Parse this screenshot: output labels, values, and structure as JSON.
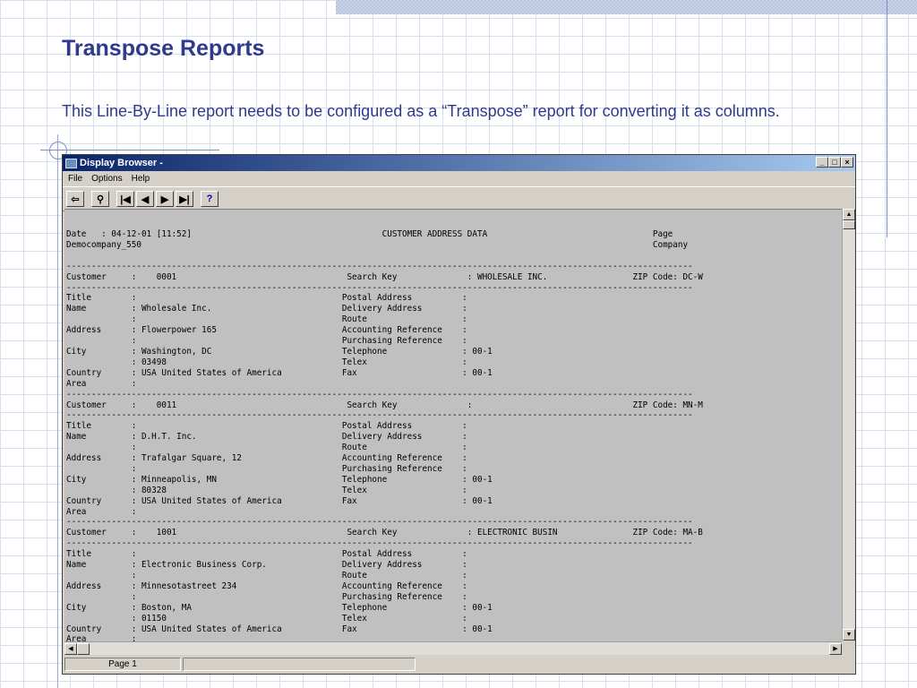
{
  "slide": {
    "title": "Transpose Reports",
    "subtitle": "This Line-By-Line report needs to be configured as a “Transpose” report for converting it as columns."
  },
  "window": {
    "title": "Display Browser -",
    "controls": {
      "minimize": "_",
      "maximize": "□",
      "close": "×"
    },
    "menu": [
      "File",
      "Options",
      "Help"
    ],
    "toolbar": [
      {
        "name": "exit-icon",
        "glyph": "⇦"
      },
      {
        "name": "binoculars-icon",
        "glyph": "⚲"
      },
      {
        "name": "first-page-icon",
        "glyph": "|◀"
      },
      {
        "name": "prev-page-icon",
        "glyph": "◀"
      },
      {
        "name": "next-page-icon",
        "glyph": "▶"
      },
      {
        "name": "last-page-icon",
        "glyph": "▶|"
      },
      {
        "name": "help-icon",
        "glyph": "?"
      }
    ],
    "status": {
      "page": "Page 1",
      "message": ""
    }
  },
  "report": {
    "lines": [
      "Date   : 04-12-01 [11:52]                                      CUSTOMER ADDRESS DATA                                 Page",
      "Democompany_550                                                                                                      Company",
      "",
      "-----------------------------------------------------------------------------------------------------------------------------",
      "Customer     :    0001                                  Search Key              : WHOLESALE INC.                 ZIP Code: DC-W",
      "-----------------------------------------------------------------------------------------------------------------------------",
      "Title        :                                         Postal Address          :",
      "Name         : Wholesale Inc.                          Delivery Address        :",
      "             :                                         Route                   :",
      "Address      : Flowerpower 165                         Accounting Reference    :",
      "             :                                         Purchasing Reference    :",
      "City         : Washington, DC                          Telephone               : 00-1",
      "             : 03498                                   Telex                   :",
      "Country      : USA United States of America            Fax                     : 00-1",
      "Area         :",
      "-----------------------------------------------------------------------------------------------------------------------------",
      "Customer     :    0011                                  Search Key              :                                ZIP Code: MN-M",
      "-----------------------------------------------------------------------------------------------------------------------------",
      "Title        :                                         Postal Address          :",
      "Name         : D.H.T. Inc.                             Delivery Address        :",
      "             :                                         Route                   :",
      "Address      : Trafalgar Square, 12                    Accounting Reference    :",
      "             :                                         Purchasing Reference    :",
      "City         : Minneapolis, MN                         Telephone               : 00-1",
      "             : 80328                                   Telex                   :",
      "Country      : USA United States of America            Fax                     : 00-1",
      "Area         :",
      "-----------------------------------------------------------------------------------------------------------------------------",
      "Customer     :    1001                                  Search Key              : ELECTRONIC BUSIN               ZIP Code: MA-B",
      "-----------------------------------------------------------------------------------------------------------------------------",
      "Title        :                                         Postal Address          :",
      "Name         : Electronic Business Corp.               Delivery Address        :",
      "             :                                         Route                   :",
      "Address      : Minnesotastreet 234                     Accounting Reference    :",
      "             :                                         Purchasing Reference    :",
      "City         : Boston, MA                              Telephone               : 00-1",
      "             : 01150                                   Telex                   :",
      "Country      : USA United States of America            Fax                     : 00-1",
      "Area         :"
    ]
  }
}
